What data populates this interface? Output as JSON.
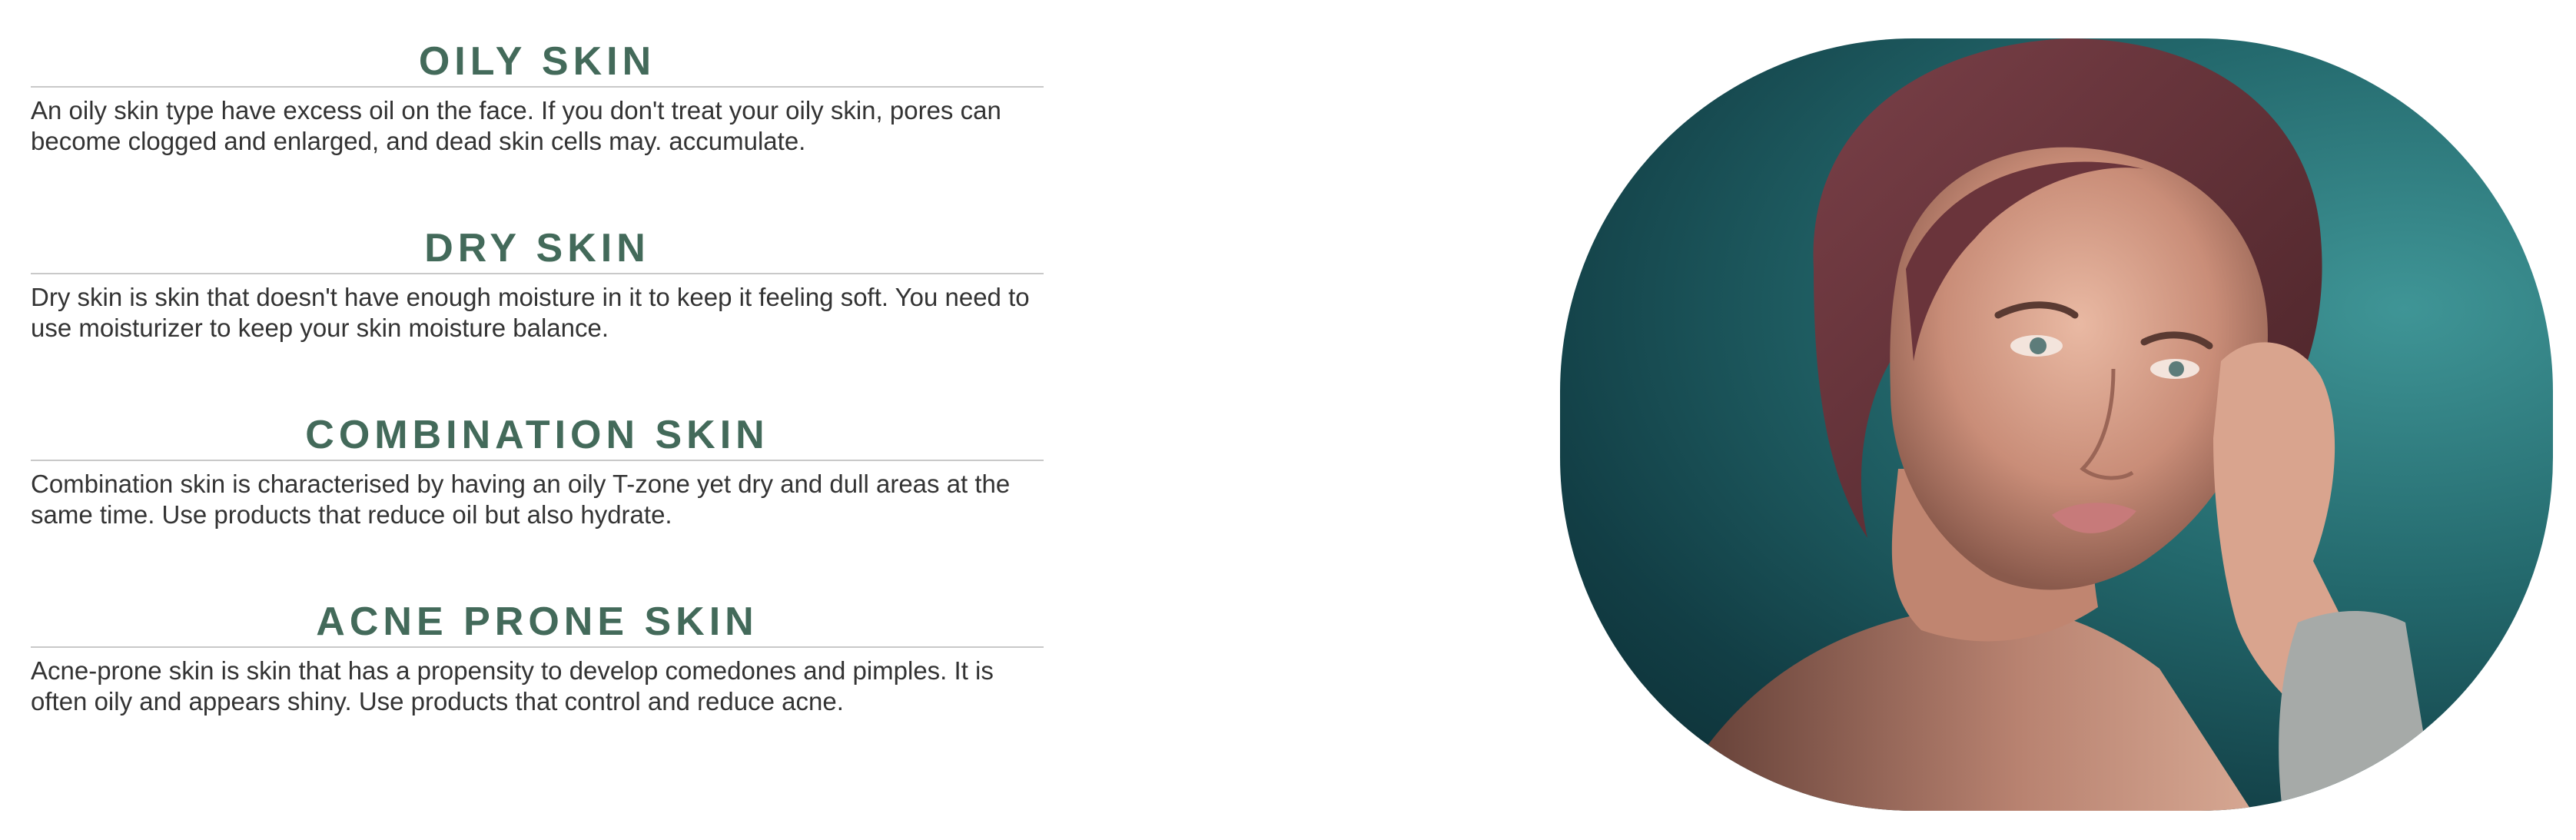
{
  "sections": [
    {
      "title": "OILY SKIN",
      "description": "An oily skin type have excess oil on the face. If you don't treat your oily skin, pores can become clogged and enlarged, and dead skin cells may. accumulate."
    },
    {
      "title": "DRY SKIN",
      "description": "Dry skin is skin that doesn't have enough moisture in it to keep it feeling soft. You need to use moisturizer to keep your skin moisture balance."
    },
    {
      "title": "COMBINATION SKIN",
      "description": "Combination skin is characterised by having an oily T-zone yet dry and dull areas at the same time. Use products that reduce oil but also hydrate."
    },
    {
      "title": "ACNE PRONE SKIN",
      "description": "Acne-prone skin is skin that has a propensity to develop comedones and pimples. It is often oily and appears shiny. Use products that control and reduce acne."
    }
  ],
  "colors": {
    "heading": "#436a5a",
    "body_text": "#333333",
    "divider": "#c9c9c9",
    "photo_background": "#23686c"
  }
}
